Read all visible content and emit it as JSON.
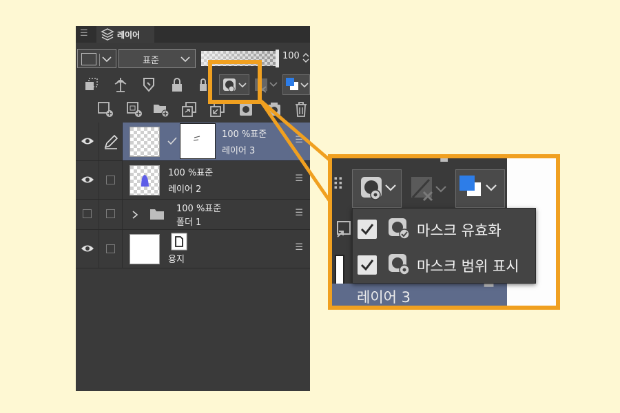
{
  "panel": {
    "tab_label": "레이어",
    "blend_mode": "표준",
    "opacity_value": "100",
    "opacity_fraction": 1.0
  },
  "layers": [
    {
      "name": "레이어 3",
      "info": "100 %표준",
      "visible": true,
      "selected": true
    },
    {
      "name": "레이어 2",
      "info": "100 %표준",
      "visible": true,
      "selected": false
    },
    {
      "name": "폴더 1",
      "info": "100 %표준",
      "visible": false,
      "selected": false
    },
    {
      "name": "용지",
      "info": "",
      "visible": true,
      "selected": false
    }
  ],
  "zoom": {
    "menu_items": [
      {
        "label": "마스크 유효화",
        "checked": true,
        "icon": "mask-enable-icon"
      },
      {
        "label": "마스크 범위 표시",
        "checked": true,
        "icon": "mask-range-icon"
      }
    ],
    "layer_label": "레이어 3"
  },
  "colors": {
    "background": "#fef8d3",
    "panel": "#3a3a3a",
    "selected_layer": "#5e6b8b",
    "highlight": "#f0a020",
    "accent_blue": "#2d7de8"
  }
}
